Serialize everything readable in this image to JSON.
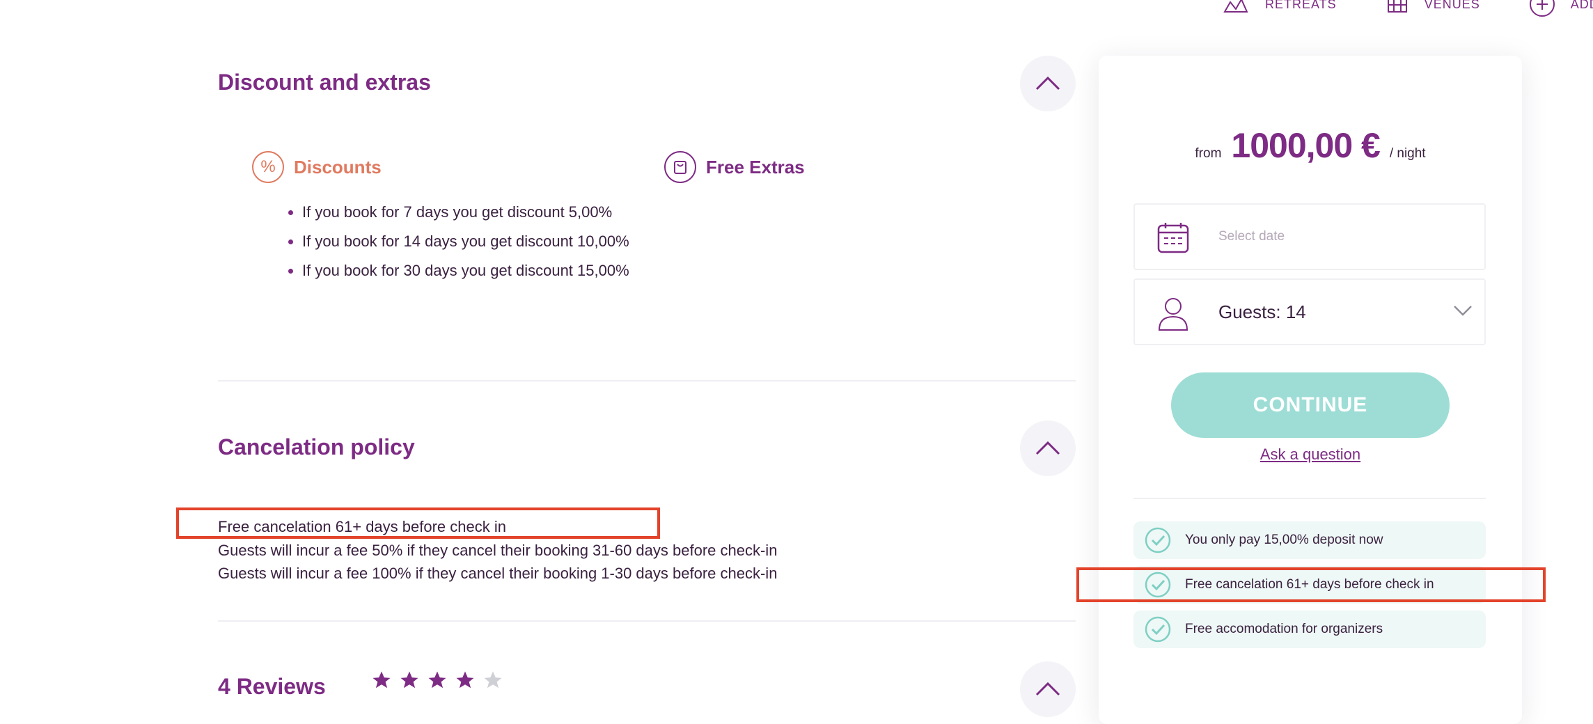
{
  "nav": {
    "items": [
      {
        "label": "RETREATS",
        "icon": "retreats-icon"
      },
      {
        "label": "VENUES",
        "icon": "venues-icon"
      },
      {
        "label": "ADD",
        "icon": "plus-circle-icon"
      }
    ]
  },
  "discounts_section": {
    "title": "Discount and extras",
    "discounts_heading": "Discounts",
    "free_extras_heading": "Free Extras",
    "items": [
      "If you book for 7 days you get discount 5,00%",
      "If you book for 14 days you get discount 10,00%",
      "If you book for 30 days you get discount 15,00%"
    ]
  },
  "cancellation_section": {
    "title": "Cancelation policy",
    "lines": [
      "Free cancelation 61+ days before check in",
      "Guests will incur a fee 50% if they cancel their booking 31-60 days before check-in",
      "Guests will incur a fee 100% if they cancel their booking 1-30 days before check-in"
    ]
  },
  "reviews_section": {
    "title": "4 Reviews",
    "rating": 4,
    "max_rating": 5
  },
  "booking": {
    "from_label": "from",
    "price": "1000,00 €",
    "unit": "/ night",
    "date_placeholder": "Select date",
    "guests_label": "Guests: 14",
    "continue_label": "CONTINUE",
    "ask_label": "Ask a question",
    "features": [
      "You only pay 15,00% deposit now",
      "Free cancelation 61+ days before check in",
      "Free accomodation for organizers"
    ]
  },
  "colors": {
    "brand_purple": "#7d2b84",
    "discount_orange": "#e07a5f",
    "teal": "#9dddd5",
    "highlight_red": "#e2432a"
  }
}
